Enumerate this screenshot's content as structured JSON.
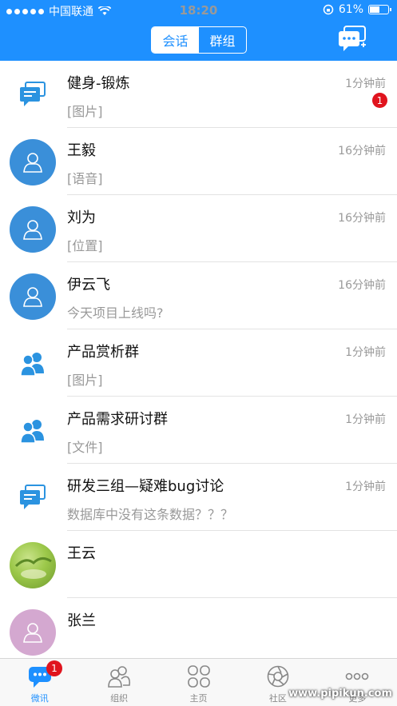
{
  "status_bar": {
    "carrier": "中国联通",
    "time": "18:20",
    "battery_percent": "61%",
    "battery_level": 0.61
  },
  "nav": {
    "segments": [
      "会话",
      "群组"
    ],
    "active_segment": 0
  },
  "conversations": [
    {
      "name": "健身-锻炼",
      "time": "1分钟前",
      "preview": "[图片]",
      "avatar": "group-chat-icon",
      "badge": "1"
    },
    {
      "name": "王毅",
      "time": "16分钟前",
      "preview": "[语音]",
      "avatar": "user-avatar-blue"
    },
    {
      "name": "刘为",
      "time": "16分钟前",
      "preview": "[位置]",
      "avatar": "user-avatar-blue"
    },
    {
      "name": "伊云飞",
      "time": "16分钟前",
      "preview": "今天项目上线吗?",
      "avatar": "user-avatar-blue"
    },
    {
      "name": "产品赏析群",
      "time": "1分钟前",
      "preview": "[图片]",
      "avatar": "group-people-icon"
    },
    {
      "name": "产品需求研讨群",
      "time": "1分钟前",
      "preview": "[文件]",
      "avatar": "group-people-icon"
    },
    {
      "name": "研发三组—疑难bug讨论",
      "time": "1分钟前",
      "preview": "数据库中没有这条数据？？？",
      "avatar": "group-chat-icon"
    },
    {
      "name": "王云",
      "time": "",
      "preview": "",
      "avatar": "photo-avatar"
    },
    {
      "name": "张兰",
      "time": "",
      "preview": "",
      "avatar": "user-avatar-pink"
    }
  ],
  "tabbar": {
    "tabs": [
      {
        "label": "微讯",
        "icon": "chat-bubble-icon",
        "badge": "1"
      },
      {
        "label": "组织",
        "icon": "organization-icon"
      },
      {
        "label": "主页",
        "icon": "home-grid-icon"
      },
      {
        "label": "社区",
        "icon": "community-aperture-icon"
      },
      {
        "label": "更多",
        "icon": "more-dots-icon"
      }
    ],
    "active": 0
  },
  "watermark": "www.pipikun.com",
  "colors": {
    "primary": "#1e90ff",
    "badge": "#e0141e",
    "avatar_blue": "#3a8fd9",
    "avatar_pink": "#d4a8d0",
    "secondary_text": "#999999"
  }
}
